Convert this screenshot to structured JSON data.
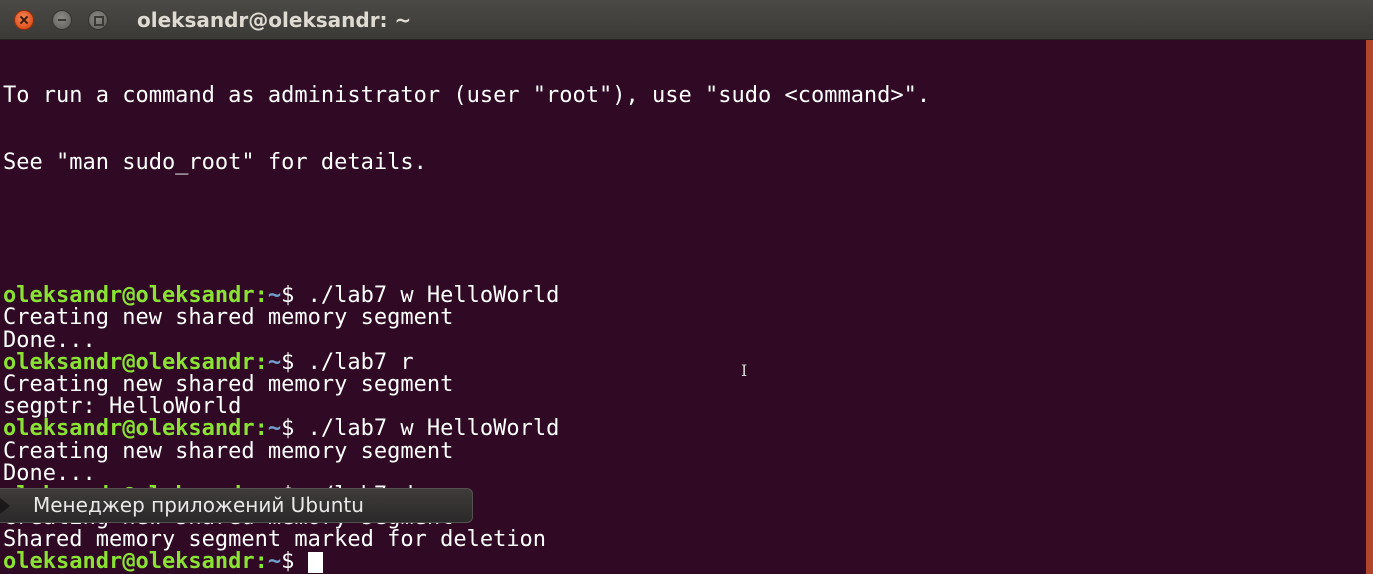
{
  "window": {
    "title": "oleksandr@oleksandr: ~"
  },
  "terminal": {
    "intro": [
      "To run a command as administrator (user \"root\"), use \"sudo <command>\".",
      "See \"man sudo_root\" for details."
    ],
    "prompt_user": "oleksandr@oleksandr",
    "prompt_sep": ":",
    "prompt_path": "~",
    "prompt_symbol": "$ ",
    "sessions": [
      {
        "command": "./lab7 w HelloWorld",
        "output": [
          "Creating new shared memory segment",
          "Done..."
        ]
      },
      {
        "command": "./lab7 r",
        "output": [
          "Creating new shared memory segment",
          "segptr: HelloWorld"
        ]
      },
      {
        "command": "./lab7 w HelloWorld",
        "output": [
          "Creating new shared memory segment",
          "Done..."
        ]
      },
      {
        "command": "./lab7 d",
        "output": [
          "Creating new shared memory segment",
          "Shared memory segment marked for deletion"
        ]
      }
    ]
  },
  "launcher_tooltip": {
    "label": "Менеджер приложений Ubuntu"
  },
  "colors": {
    "background": "#300a24",
    "prompt_user": "#8ae234",
    "prompt_path": "#729fcf",
    "text": "#ffffff"
  },
  "icons": {
    "close": "close-icon",
    "minimize": "minimize-icon",
    "maximize": "maximize-icon",
    "text_cursor": "i-beam-icon"
  }
}
